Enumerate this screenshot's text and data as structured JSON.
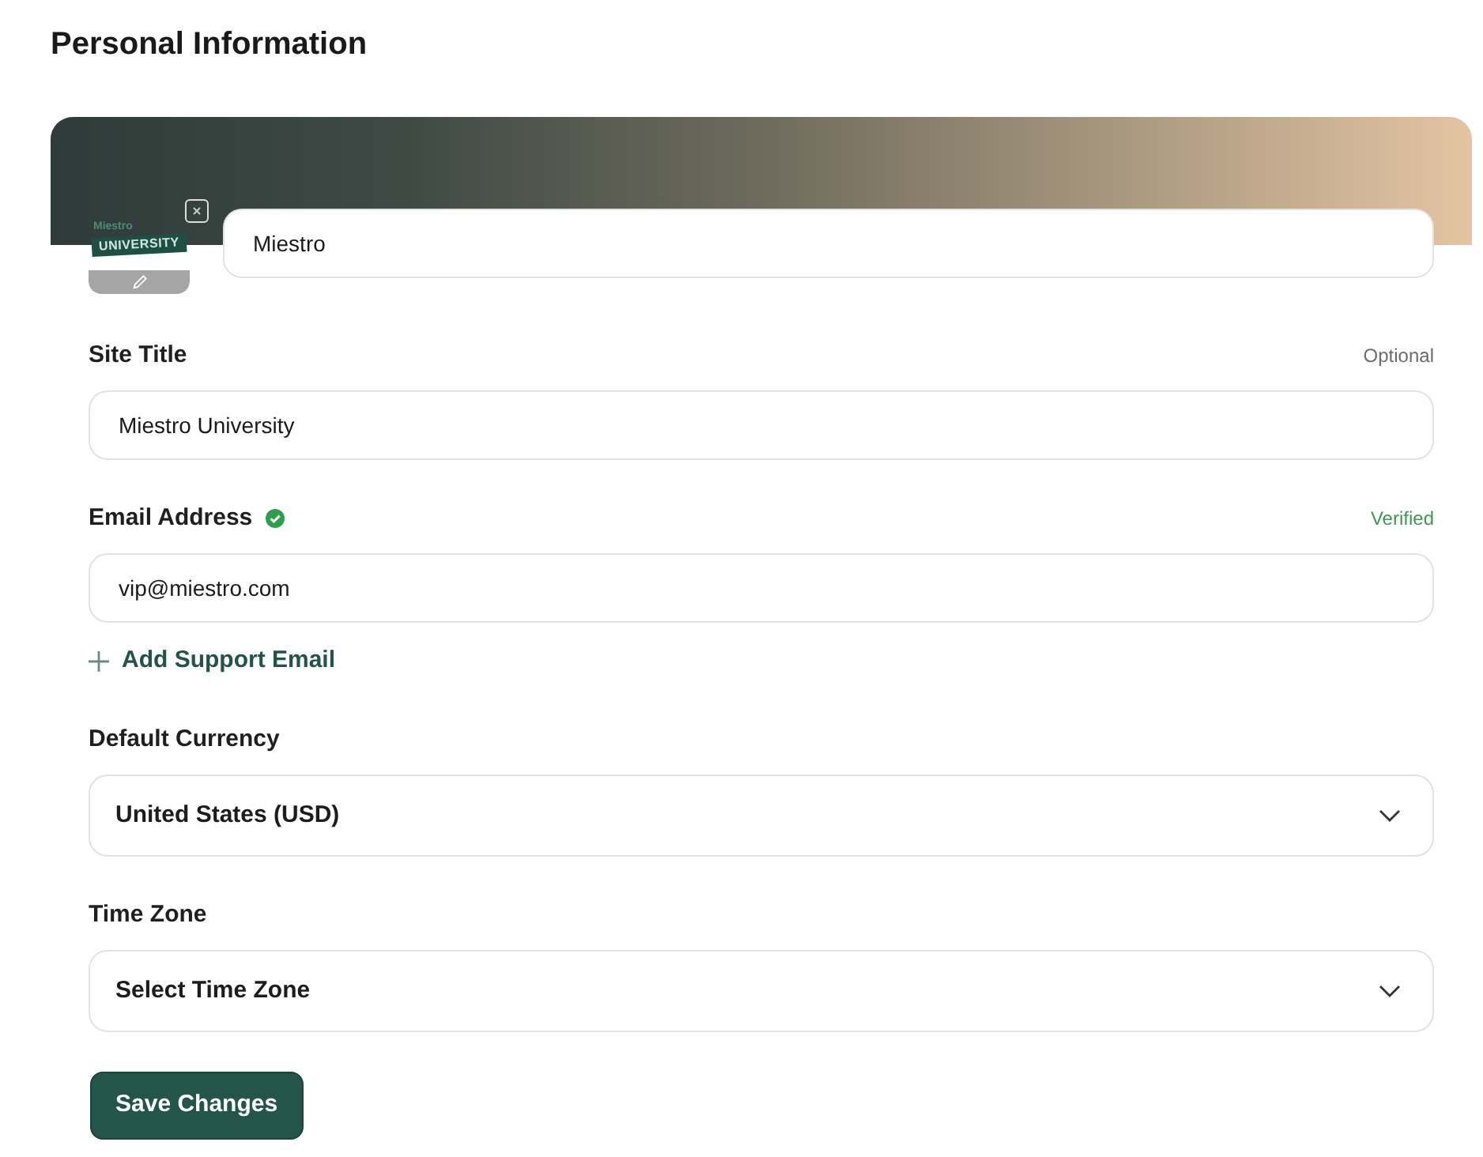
{
  "heading": "Personal Information",
  "profile": {
    "logo_texts": [
      "Miestro",
      "UNIVERSITY"
    ],
    "name_value": "Miestro"
  },
  "items": [
    {
      "kind": "input",
      "label": "Site Title",
      "note": "Optional",
      "verified": false,
      "value": "Miestro University"
    },
    {
      "kind": "input",
      "label": "Email Address",
      "note": "Verified",
      "verified": true,
      "value": "vip@miestro.com"
    },
    {
      "kind": "link",
      "label": "Add Support Email"
    },
    {
      "kind": "select",
      "label": "Default Currency",
      "value": "United States (USD)"
    },
    {
      "kind": "select",
      "label": "Time Zone",
      "value": "Select Time Zone"
    }
  ],
  "save_button": "Save Changes"
}
